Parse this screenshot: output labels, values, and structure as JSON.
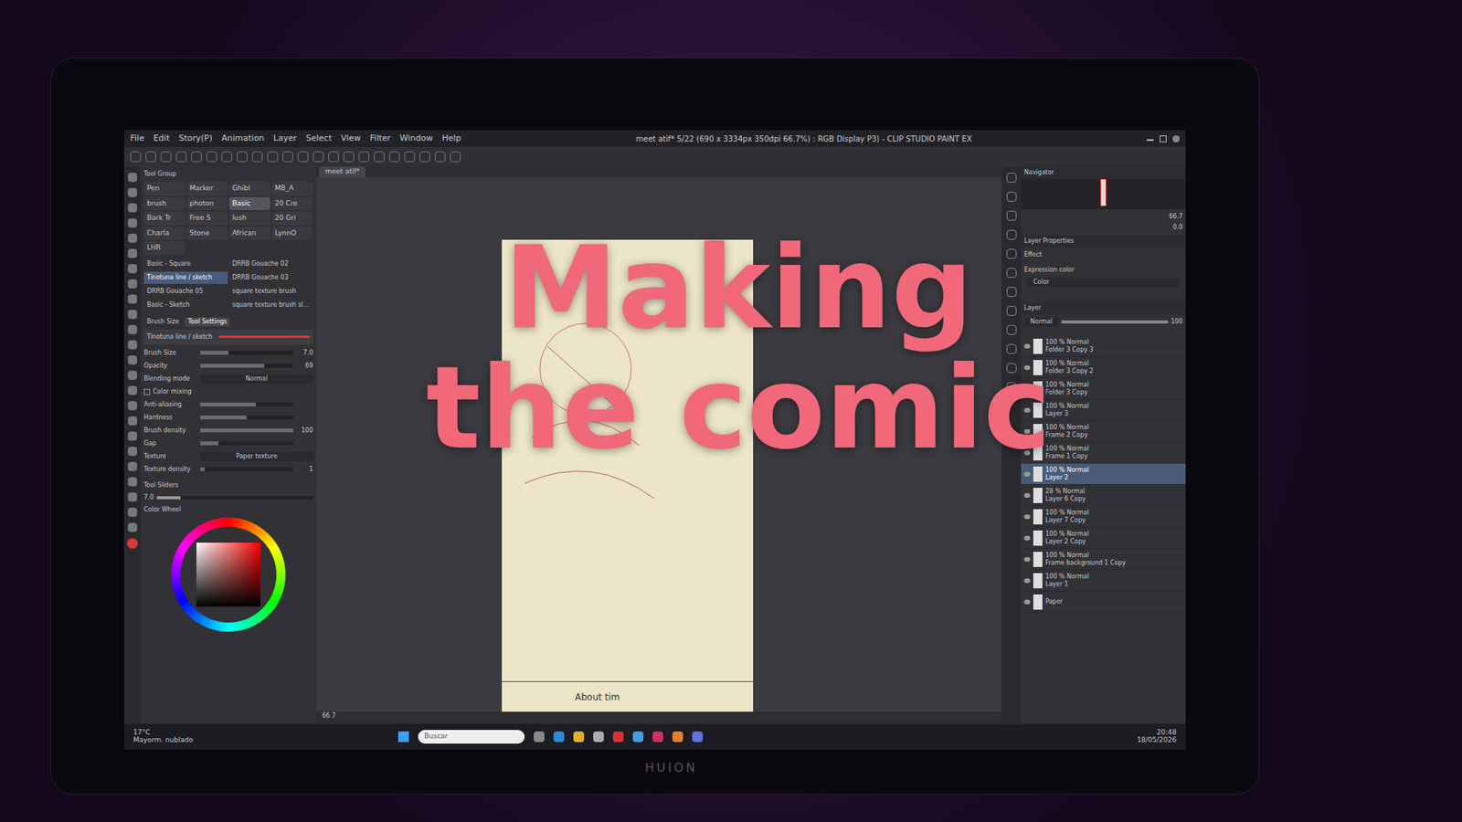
{
  "overlay": {
    "lines": [
      "Making",
      "the comic"
    ]
  },
  "monitor": {
    "brand": "HUION"
  },
  "window": {
    "title": "meet atif* 5/22 (690 x 3334px 350dpi 66.7%) : RGB Display P3) - CLIP STUDIO PAINT EX"
  },
  "menu": [
    "File",
    "Edit",
    "Story(P)",
    "Animation",
    "Layer",
    "Select",
    "View",
    "Filter",
    "Window",
    "Help"
  ],
  "document_tab": {
    "label": "meet atif*"
  },
  "tool_group": {
    "title": "Tool Group",
    "tabs": [
      {
        "label": "Pen",
        "selected": false
      },
      {
        "label": "Marker",
        "selected": false
      },
      {
        "label": "Ghibl",
        "selected": false
      },
      {
        "label": "MB_A",
        "selected": false
      },
      {
        "label": "brush",
        "selected": false
      },
      {
        "label": "photon",
        "selected": false
      },
      {
        "label": "Basic",
        "selected": true
      },
      {
        "label": "20 Cre",
        "selected": false
      },
      {
        "label": "Bark Tr",
        "selected": false
      },
      {
        "label": "Free S",
        "selected": false
      },
      {
        "label": "lush",
        "selected": false
      },
      {
        "label": "20 Gri",
        "selected": false
      },
      {
        "label": "Charla",
        "selected": false
      },
      {
        "label": "Stone",
        "selected": false
      },
      {
        "label": "African",
        "selected": false
      },
      {
        "label": "LynnO",
        "selected": false
      },
      {
        "label": "LHR",
        "selected": false
      }
    ]
  },
  "brushes": [
    {
      "name": "Basic - Square",
      "selected": false
    },
    {
      "name": "DRRB Gouache 02",
      "selected": false
    },
    {
      "name": "Tinotuna line / sketch",
      "selected": true
    },
    {
      "name": "DRRB Gouache 03",
      "selected": false
    },
    {
      "name": "DRRB Gouache 05",
      "selected": false
    },
    {
      "name": "square texture brush",
      "selected": false
    },
    {
      "name": "Basic - Sketch",
      "selected": false
    },
    {
      "name": "square texture brush slab",
      "selected": false
    }
  ],
  "tool_settings": {
    "tabs": [
      {
        "label": "Brush Size",
        "selected": false
      },
      {
        "label": "Tool Settings",
        "selected": true
      }
    ],
    "brush_name": "Tinotuna line / sketch",
    "rows": [
      {
        "kind": "slider",
        "label": "Brush Size",
        "reading": "7.0",
        "level": 0.3
      },
      {
        "kind": "slider",
        "label": "Opacity",
        "reading": "69",
        "level": 0.69
      },
      {
        "kind": "dropdown",
        "label": "Blending mode",
        "reading": "Normal"
      },
      {
        "kind": "check",
        "label": "Color mixing",
        "checked": false
      },
      {
        "kind": "slider",
        "label": "Anti-aliasing",
        "reading": "",
        "level": 0.6
      },
      {
        "kind": "slider",
        "label": "Hardness",
        "reading": "",
        "level": 0.5
      },
      {
        "kind": "slider",
        "label": "Brush density",
        "reading": "100",
        "level": 1.0
      },
      {
        "kind": "slider",
        "label": "Gap",
        "reading": "",
        "level": 0.2
      },
      {
        "kind": "dropdown",
        "label": "Texture",
        "reading": "Paper texture"
      },
      {
        "kind": "slider",
        "label": "Texture density",
        "reading": "1",
        "level": 0.05
      }
    ]
  },
  "tool_sliders": {
    "title": "Tool Sliders",
    "reading": "7.0",
    "level": 0.15
  },
  "color_wheel": {
    "title": "Color Wheel",
    "color": "#d83a3a"
  },
  "navigator": {
    "title": "Navigator",
    "zoom": "66.7",
    "rotation": "0.0"
  },
  "layer_properties": {
    "title": "Layer Properties",
    "effect": "Effect",
    "expression_label": "Expression color",
    "expression_value": "Color"
  },
  "layer_panel": {
    "title": "Layer",
    "mode": "Normal",
    "opacity": "100",
    "layers": [
      {
        "mode": "100 % Normal",
        "name": "Folder 3 Copy 3",
        "selected": false
      },
      {
        "mode": "100 % Normal",
        "name": "Folder 3 Copy 2",
        "selected": false
      },
      {
        "mode": "100 % Normal",
        "name": "Folder 3 Copy",
        "selected": false
      },
      {
        "mode": "100 % Normal",
        "name": "Layer 3",
        "selected": false
      },
      {
        "mode": "100 % Normal",
        "name": "Frame 2 Copy",
        "selected": false
      },
      {
        "mode": "100 % Normal",
        "name": "Frame 1 Copy",
        "selected": false
      },
      {
        "mode": "100 % Normal",
        "name": "Layer 2",
        "selected": true
      },
      {
        "mode": "28 % Normal",
        "name": "Layer 6 Copy",
        "selected": false
      },
      {
        "mode": "100 % Normal",
        "name": "Layer 7 Copy",
        "selected": false
      },
      {
        "mode": "100 % Normal",
        "name": "Layer 2 Copy",
        "selected": false
      },
      {
        "mode": "100 % Normal",
        "name": "Frame background 1 Copy",
        "selected": false
      },
      {
        "mode": "100 % Normal",
        "name": "Layer 1",
        "selected": false
      },
      {
        "mode": "",
        "name": "Paper",
        "selected": false
      }
    ]
  },
  "canvas": {
    "caption": "About tim",
    "status_zoom": "66.7"
  },
  "taskbar": {
    "weather_temp": "17°C",
    "weather_text": "Mayorm. nublado",
    "search_placeholder": "Buscar",
    "time": "20:48",
    "date": "18/05/2026"
  }
}
